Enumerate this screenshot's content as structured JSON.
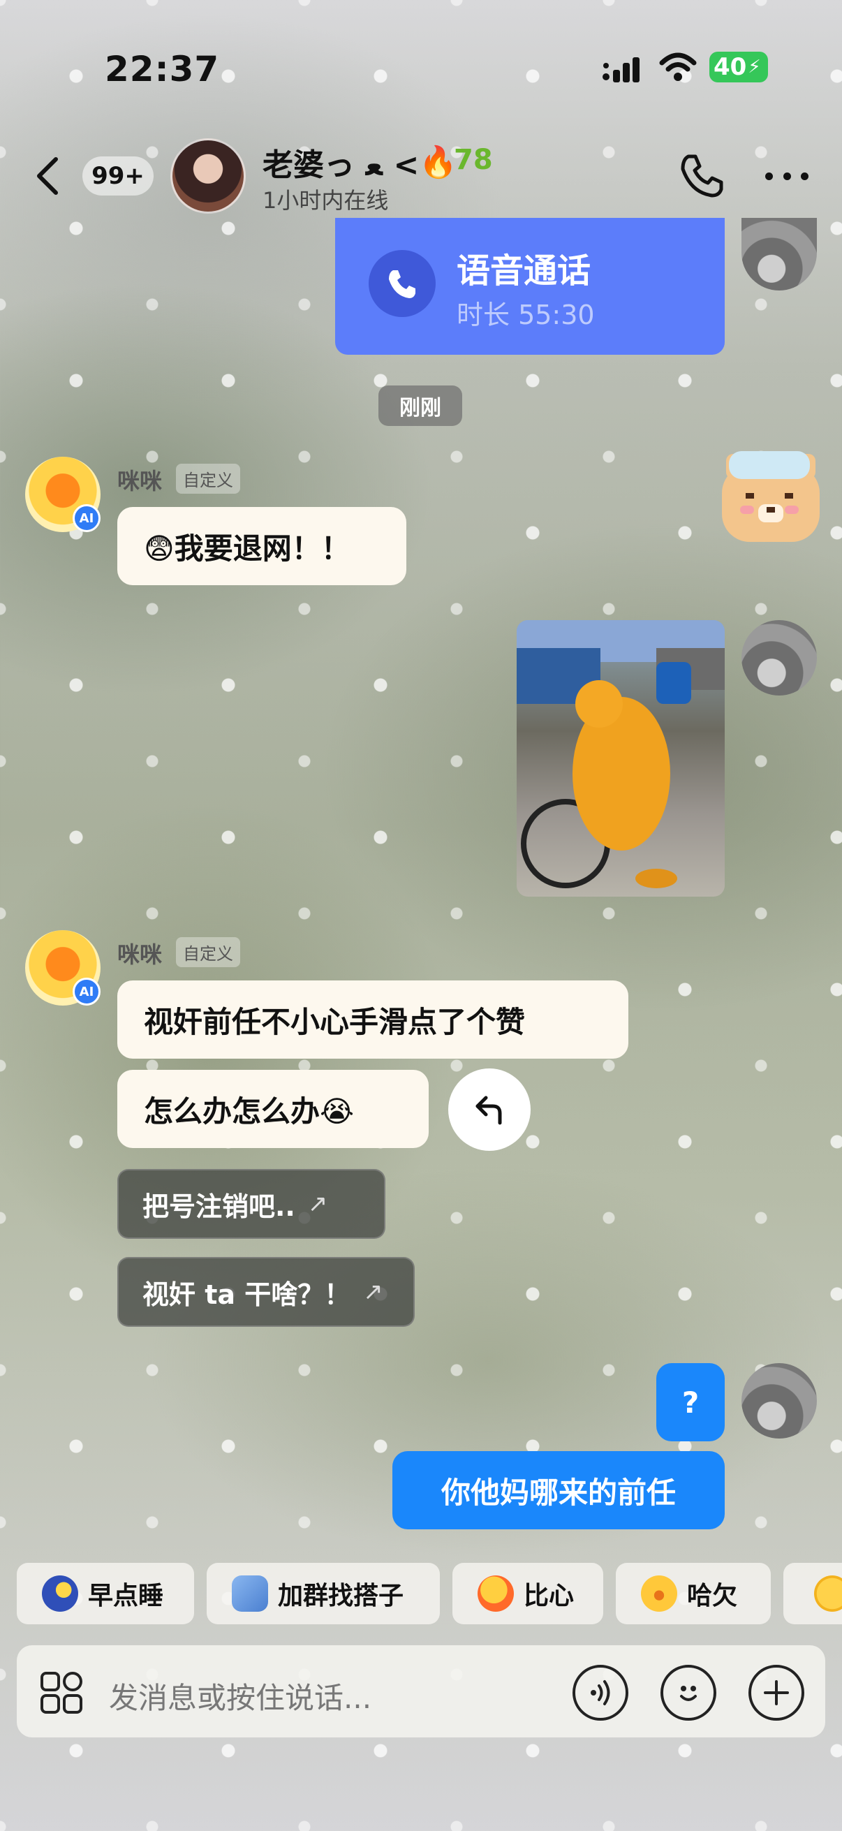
{
  "status_bar": {
    "time": "22:37",
    "battery": "40"
  },
  "header": {
    "unread_count": "99+",
    "contact_name": "老婆っ ﻌ <",
    "heat_value": "78",
    "online_status": "1小时内在线"
  },
  "call_card": {
    "title": "语音通话",
    "duration": "时长 55:30"
  },
  "timestamp": "刚刚",
  "messages": {
    "ai_sender_1": "咪咪",
    "ai_tag_1": "自定义",
    "ai_msg_1": "😨我要退网！！",
    "ai_sender_2": "咪咪",
    "ai_tag_2": "自定义",
    "ai_msg_2": "视奸前任不小心手滑点了个赞",
    "ai_msg_3": "怎么办怎么办😭",
    "out_msg_1": "?",
    "out_msg_2": "你他妈哪来的前任"
  },
  "suggestions": [
    {
      "label": "把号注销吧..",
      "arrow": "↗"
    },
    {
      "label": "视奸 ta 干啥？！",
      "arrow": "↗"
    }
  ],
  "quick_chips": [
    {
      "label": "早点睡",
      "color": "#2f4fb8"
    },
    {
      "label": "加群找搭子",
      "color": "#6ea3e8"
    },
    {
      "label": "比心",
      "color": "#ff9a2a"
    },
    {
      "label": "哈欠",
      "color": "#ffc83a"
    }
  ],
  "input": {
    "placeholder": "发消息或按住说话..."
  },
  "ai_badge": "AI"
}
